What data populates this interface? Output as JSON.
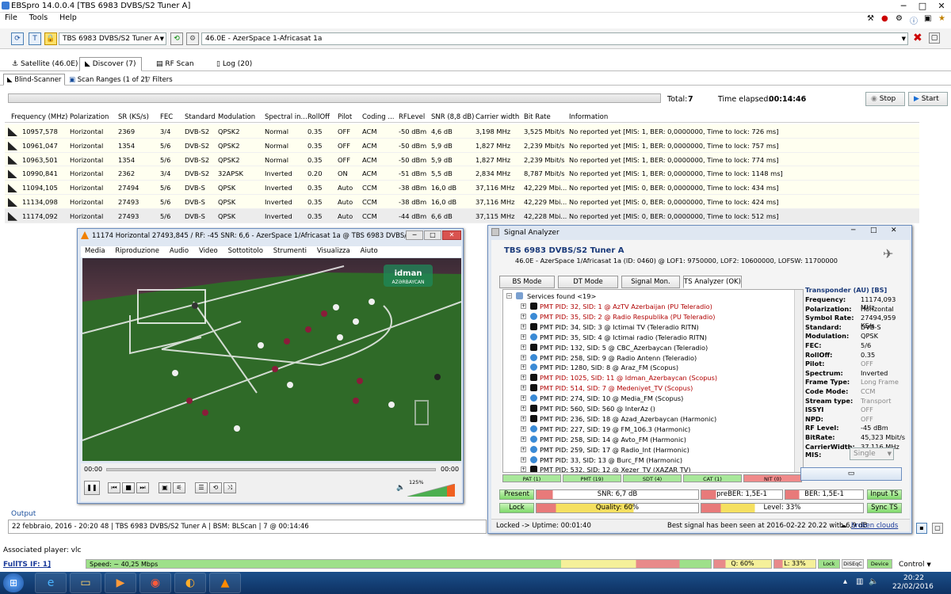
{
  "window": {
    "title": "EBSpro 14.0.0.4 [TBS 6983 DVBS/S2 Tuner A]"
  },
  "menu": [
    "File",
    "Tools",
    "Help"
  ],
  "toolbar": {
    "tuner": "TBS 6983 DVBS/S2 Tuner A",
    "satellite": "46.0E - AzerSpace 1-Africasat 1a"
  },
  "tabs": [
    {
      "label": "Satellite (46.0E)"
    },
    {
      "label": "Discover (7)"
    },
    {
      "label": "RF Scan"
    },
    {
      "label": "Log (20)"
    }
  ],
  "subtabs": [
    {
      "label": "Blind-Scanner"
    },
    {
      "label": "Scan Ranges (1 of 2)"
    },
    {
      "label": "Filters"
    }
  ],
  "scan": {
    "total_label": "Total:",
    "total": "7",
    "elapsed_label": "Time elapsed:",
    "elapsed": "00:14:46",
    "stop": "Stop",
    "start": "Start"
  },
  "table": {
    "headers": [
      "Frequency (MHz)",
      "Polarization",
      "SR (KS/s)",
      "FEC",
      "Standard",
      "Modulation",
      "Spectral in...",
      "RollOff",
      "Pilot",
      "Coding ...",
      "RFLevel",
      "SNR (8,8 dB)",
      "Carrier width",
      "Bit Rate",
      "Information"
    ],
    "rows": [
      [
        "10957,578",
        "Horizontal",
        "2369",
        "3/4",
        "DVB-S2",
        "QPSK2",
        "Normal",
        "0.35",
        "OFF",
        "ACM",
        "-50 dBm",
        "4,6 dB",
        "3,198 MHz",
        "3,525 Mbit/s",
        "No reported yet [MIS: 1, BER: 0,0000000, Time to lock: 726 ms]"
      ],
      [
        "10961,047",
        "Horizontal",
        "1354",
        "5/6",
        "DVB-S2",
        "QPSK2",
        "Normal",
        "0.35",
        "OFF",
        "ACM",
        "-50 dBm",
        "5,9 dB",
        "1,827 MHz",
        "2,239 Mbit/s",
        "No reported yet [MIS: 1, BER: 0,0000000, Time to lock: 757 ms]"
      ],
      [
        "10963,501",
        "Horizontal",
        "1354",
        "5/6",
        "DVB-S2",
        "QPSK2",
        "Normal",
        "0.35",
        "OFF",
        "ACM",
        "-50 dBm",
        "5,9 dB",
        "1,827 MHz",
        "2,239 Mbit/s",
        "No reported yet [MIS: 1, BER: 0,0000000, Time to lock: 774 ms]"
      ],
      [
        "10990,841",
        "Horizontal",
        "2362",
        "3/4",
        "DVB-S2",
        "32APSK",
        "Inverted",
        "0.20",
        "ON",
        "ACM",
        "-51 dBm",
        "5,5 dB",
        "2,834 MHz",
        "8,787 Mbit/s",
        "No reported yet [MIS: 1, BER: 0,0000000, Time to lock: 1148 ms]"
      ],
      [
        "11094,105",
        "Horizontal",
        "27494",
        "5/6",
        "DVB-S",
        "QPSK",
        "Inverted",
        "0.35",
        "Auto",
        "CCM",
        "-38 dBm",
        "16,0 dB",
        "37,116 MHz",
        "42,229 Mbi...",
        "No reported yet [MIS: 0, BER: 0,0000000, Time to lock: 434 ms]"
      ],
      [
        "11134,098",
        "Horizontal",
        "27493",
        "5/6",
        "DVB-S",
        "QPSK",
        "Inverted",
        "0.35",
        "Auto",
        "CCM",
        "-38 dBm",
        "16,0 dB",
        "37,116 MHz",
        "42,229 Mbi...",
        "No reported yet [MIS: 0, BER: 0,0000000, Time to lock: 424 ms]"
      ],
      [
        "11174,092",
        "Horizontal",
        "27493",
        "5/6",
        "DVB-S",
        "QPSK",
        "Inverted",
        "0.35",
        "Auto",
        "CCM",
        "-44 dBm",
        "6,6 dB",
        "37,115 MHz",
        "42,228 Mbi...",
        "No reported yet [MIS: 0, BER: 0,0000000, Time to lock: 512 ms]"
      ]
    ]
  },
  "vlc": {
    "title": "11174 Horizontal 27493,845 / RF: -45 SNR: 6,6 - AzerSpace 1/Africasat 1a @ TBS 6983 DVBS/S2 Tuner...",
    "menu": [
      "Media",
      "Riproduzione",
      "Audio",
      "Video",
      "Sottotitolo",
      "Strumenti",
      "Visualizza",
      "Aiuto"
    ],
    "time_left": "00:00",
    "time_right": "00:00",
    "volume": "125%",
    "logo_line1": "idman",
    "logo_line2": "AZƏRBAYCAN"
  },
  "signal_analyzer": {
    "title": "Signal Analyzer",
    "tuner": "TBS 6983 DVBS/S2 Tuner A",
    "info": "46.0E - AzerSpace 1/Africasat 1a (ID: 0460) @ LOF1: 9750000, LOF2: 10600000, LOFSW: 11700000",
    "tabs": [
      "BS Mode",
      "DT Mode",
      "Signal Mon.",
      "TS Analyzer (OK)"
    ],
    "services_header": "Services found <19>",
    "services": [
      {
        "text": "PMT PID: 32, SID: 1 @ AzTV Azerbaijan (PU Teleradio)",
        "red": true,
        "kind": "tv"
      },
      {
        "text": "PMT PID: 35, SID: 2 @ Radio Respublika (PU Teleradio)",
        "red": true,
        "kind": "radio"
      },
      {
        "text": "PMT PID: 34, SID: 3 @ Ictimai TV (Teleradio RITN)",
        "red": false,
        "kind": "tv"
      },
      {
        "text": "PMT PID: 35, SID: 4 @ Ictimai radio (Teleradio RITN)",
        "red": false,
        "kind": "radio"
      },
      {
        "text": "PMT PID: 132, SID: 5 @ CBC_Azerbaycan (Teleradio)",
        "red": false,
        "kind": "tv"
      },
      {
        "text": "PMT PID: 258, SID: 9 @ Radio Antenn (Teleradio)",
        "red": false,
        "kind": "radio"
      },
      {
        "text": "PMT PID: 1280, SID: 8 @ Araz_FM (Scopus)",
        "red": false,
        "kind": "radio"
      },
      {
        "text": "PMT PID: 1025, SID: 11 @ Idman_Azerbaycan (Scopus)",
        "red": true,
        "kind": "tv"
      },
      {
        "text": "PMT PID: 514, SID: 7 @ Medeniyet_TV (Scopus)",
        "red": true,
        "kind": "tv"
      },
      {
        "text": "PMT PID: 274, SID: 10 @ Media_FM (Scopus)",
        "red": false,
        "kind": "radio"
      },
      {
        "text": "PMT PID: 560, SID: 560 @ InterAz ()",
        "red": false,
        "kind": "tv"
      },
      {
        "text": "PMT PID: 236, SID: 18 @ Azad_Azerbaycan (Harmonic)",
        "red": false,
        "kind": "tv"
      },
      {
        "text": "PMT PID: 227, SID: 19 @ FM_106.3 (Harmonic)",
        "red": false,
        "kind": "radio"
      },
      {
        "text": "PMT PID: 258, SID: 14 @ Avto_FM (Harmonic)",
        "red": false,
        "kind": "radio"
      },
      {
        "text": "PMT PID: 259, SID: 17 @ Radio_Int (Harmonic)",
        "red": false,
        "kind": "radio"
      },
      {
        "text": "PMT PID: 33, SID: 13 @ Burc_FM (Harmonic)",
        "red": false,
        "kind": "radio"
      },
      {
        "text": "PMT PID: 532, SID: 12 @ Xezer_TV (XAZAR TV)",
        "red": false,
        "kind": "tv"
      }
    ],
    "table_tabs": [
      {
        "label": "PAT (1)",
        "color": "#a8e89a"
      },
      {
        "label": "PMT (19)",
        "color": "#a8e89a"
      },
      {
        "label": "SDT (4)",
        "color": "#a8e89a"
      },
      {
        "label": "CAT (1)",
        "color": "#a8e89a"
      },
      {
        "label": "NIT (0)",
        "color": "#f08a8a"
      }
    ],
    "transponder": {
      "header": "Transponder (AU) [BS]",
      "fields": [
        {
          "k": "Frequency:",
          "v": "11174,093 MHz"
        },
        {
          "k": "Polarization:",
          "v": "Horizontal"
        },
        {
          "k": "Symbol Rate:",
          "v": "27494,959 KS/s"
        },
        {
          "k": "Standard:",
          "v": "DVB-S"
        },
        {
          "k": "Modulation:",
          "v": "QPSK"
        },
        {
          "k": "FEC:",
          "v": "5/6"
        },
        {
          "k": "RollOff:",
          "v": "0.35"
        },
        {
          "k": "Pilot:",
          "v": "OFF"
        },
        {
          "k": "Spectrum:",
          "v": "Inverted"
        },
        {
          "k": "Frame Type:",
          "v": "Long Frame"
        },
        {
          "k": "Code Mode:",
          "v": "CCM"
        },
        {
          "k": "Stream type:",
          "v": "Transport"
        },
        {
          "k": "ISSYI",
          "v": "OFF"
        },
        {
          "k": "NPD:",
          "v": "OFF"
        },
        {
          "k": "RF Level:",
          "v": "-45 dBm"
        },
        {
          "k": "BitRate:",
          "v": "45,323 Mbit/s"
        },
        {
          "k": "CarrierWidth:",
          "v": "37,116 MHz"
        }
      ],
      "mis_label": "MIS:",
      "mis_value": "Single"
    },
    "indicators": {
      "present": "Present",
      "lock": "Lock",
      "snr": "SNR: 6,7 dB",
      "quality": "Quality: 60%",
      "quality_fraction": 0.6,
      "preber": "preBER: 1,5E-1",
      "ber": "BER: 1,5E-1",
      "level": "Level: 33%",
      "level_fraction": 0.33,
      "input_ts": "Input TS",
      "sync_ts": "Sync TS"
    },
    "status_left": "Locked -> Uptime: 00:01:40",
    "status_right": "Best signal has been seen at 2016-02-22 20.22 with 6,9 dB",
    "status_link": "broken clouds"
  },
  "output": {
    "label": "Output",
    "line": "22 febbraio, 2016 - 20:20 48 | TBS 6983 DVBS/S2 Tuner A | BSM: BLScan | 7 @ 00:14:46"
  },
  "statusbar": {
    "player": "Associated player: vlc",
    "fullts": "FullTS IF: 1]",
    "speed": "Speed: ~ 40,25 Mbps",
    "q": "Q: 60%",
    "l": "L: 33%",
    "lock": "Lock",
    "diseqc": "DiSEqC",
    "device": "Device",
    "control": "Control"
  },
  "taskbar": {
    "time": "20:22",
    "date": "22/02/2016"
  }
}
